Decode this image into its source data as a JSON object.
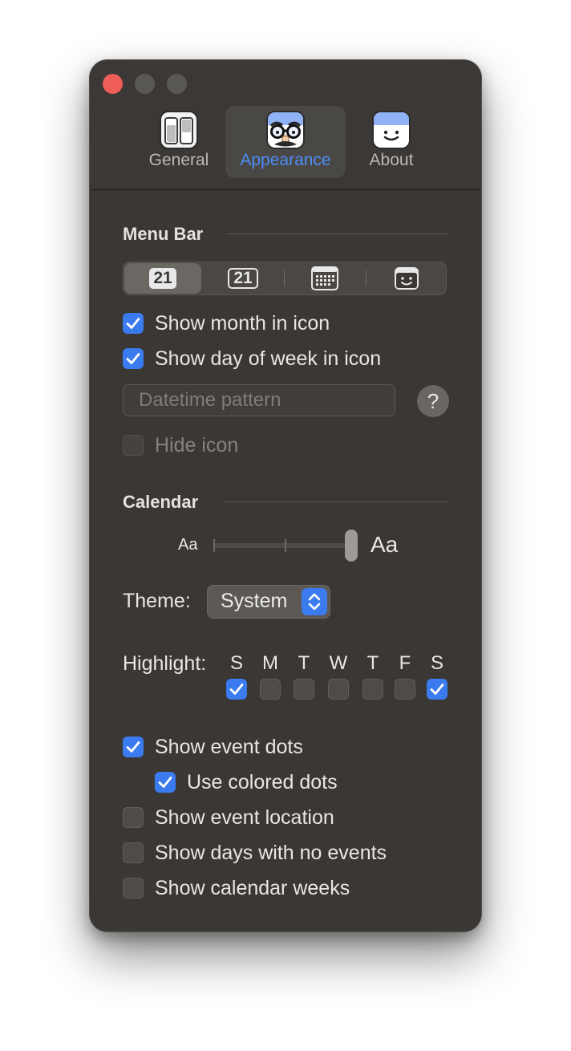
{
  "window": {
    "toolbar": {
      "tabs": [
        {
          "label": "General",
          "icon": "general-icon",
          "selected": false
        },
        {
          "label": "Appearance",
          "icon": "appearance-icon",
          "selected": true
        },
        {
          "label": "About",
          "icon": "about-icon",
          "selected": false
        }
      ]
    }
  },
  "menu_bar": {
    "title": "Menu Bar",
    "icon_styles": [
      {
        "label": "21",
        "kind": "filled-date",
        "selected": true
      },
      {
        "label": "21",
        "kind": "outlined-date",
        "selected": false
      },
      {
        "label": "",
        "kind": "calendar-grid-icon",
        "selected": false
      },
      {
        "label": "",
        "kind": "face-icon",
        "selected": false
      }
    ],
    "show_month": {
      "label": "Show month in icon",
      "checked": true
    },
    "show_day_of_week": {
      "label": "Show day of week in icon",
      "checked": true
    },
    "datetime_pattern": {
      "placeholder": "Datetime pattern",
      "value": ""
    },
    "help": "?",
    "hide_icon": {
      "label": "Hide icon",
      "checked": false,
      "enabled": false
    }
  },
  "calendar": {
    "title": "Calendar",
    "text_size": {
      "small_label": "Aa",
      "large_label": "Aa",
      "level": 1.0
    },
    "theme": {
      "label": "Theme:",
      "value": "System"
    },
    "highlight": {
      "label": "Highlight:",
      "days": [
        {
          "letter": "S",
          "checked": true
        },
        {
          "letter": "M",
          "checked": false
        },
        {
          "letter": "T",
          "checked": false
        },
        {
          "letter": "W",
          "checked": false
        },
        {
          "letter": "T",
          "checked": false
        },
        {
          "letter": "F",
          "checked": false
        },
        {
          "letter": "S",
          "checked": true
        }
      ]
    },
    "show_event_dots": {
      "label": "Show event dots",
      "checked": true
    },
    "use_colored_dots": {
      "label": "Use colored dots",
      "checked": true
    },
    "show_event_location": {
      "label": "Show event location",
      "checked": false
    },
    "show_days_no_events": {
      "label": "Show days with no events",
      "checked": false
    },
    "show_calendar_weeks": {
      "label": "Show calendar weeks",
      "checked": false
    }
  },
  "colors": {
    "accent": "#3a7bf0",
    "window_bg": "#3a3734",
    "close": "#ee5e57"
  }
}
